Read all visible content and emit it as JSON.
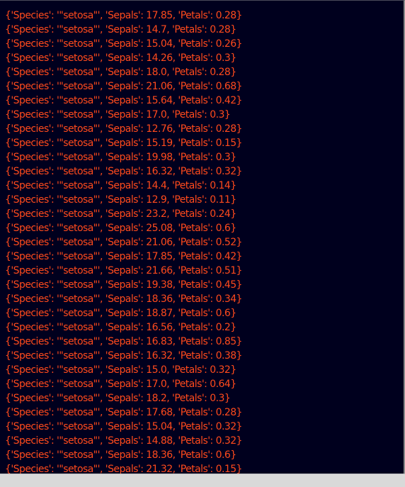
{
  "terminal": {
    "text_color": "#ff4a1c",
    "background_color": "#00001e",
    "lines": [
      "{'Species': '\"setosa\"', 'Sepals': 17.85, 'Petals': 0.28}",
      "{'Species': '\"setosa\"', 'Sepals': 14.7, 'Petals': 0.28}",
      "{'Species': '\"setosa\"', 'Sepals': 15.04, 'Petals': 0.26}",
      "{'Species': '\"setosa\"', 'Sepals': 14.26, 'Petals': 0.3}",
      "{'Species': '\"setosa\"', 'Sepals': 18.0, 'Petals': 0.28}",
      "{'Species': '\"setosa\"', 'Sepals': 21.06, 'Petals': 0.68}",
      "{'Species': '\"setosa\"', 'Sepals': 15.64, 'Petals': 0.42}",
      "{'Species': '\"setosa\"', 'Sepals': 17.0, 'Petals': 0.3}",
      "{'Species': '\"setosa\"', 'Sepals': 12.76, 'Petals': 0.28}",
      "{'Species': '\"setosa\"', 'Sepals': 15.19, 'Petals': 0.15}",
      "{'Species': '\"setosa\"', 'Sepals': 19.98, 'Petals': 0.3}",
      "{'Species': '\"setosa\"', 'Sepals': 16.32, 'Petals': 0.32}",
      "{'Species': '\"setosa\"', 'Sepals': 14.4, 'Petals': 0.14}",
      "{'Species': '\"setosa\"', 'Sepals': 12.9, 'Petals': 0.11}",
      "{'Species': '\"setosa\"', 'Sepals': 23.2, 'Petals': 0.24}",
      "{'Species': '\"setosa\"', 'Sepals': 25.08, 'Petals': 0.6}",
      "{'Species': '\"setosa\"', 'Sepals': 21.06, 'Petals': 0.52}",
      "{'Species': '\"setosa\"', 'Sepals': 17.85, 'Petals': 0.42}",
      "{'Species': '\"setosa\"', 'Sepals': 21.66, 'Petals': 0.51}",
      "{'Species': '\"setosa\"', 'Sepals': 19.38, 'Petals': 0.45}",
      "{'Species': '\"setosa\"', 'Sepals': 18.36, 'Petals': 0.34}",
      "{'Species': '\"setosa\"', 'Sepals': 18.87, 'Petals': 0.6}",
      "{'Species': '\"setosa\"', 'Sepals': 16.56, 'Petals': 0.2}",
      "{'Species': '\"setosa\"', 'Sepals': 16.83, 'Petals': 0.85}",
      "{'Species': '\"setosa\"', 'Sepals': 16.32, 'Petals': 0.38}",
      "{'Species': '\"setosa\"', 'Sepals': 15.0, 'Petals': 0.32}",
      "{'Species': '\"setosa\"', 'Sepals': 17.0, 'Petals': 0.64}",
      "{'Species': '\"setosa\"', 'Sepals': 18.2, 'Petals': 0.3}",
      "{'Species': '\"setosa\"', 'Sepals': 17.68, 'Petals': 0.28}",
      "{'Species': '\"setosa\"', 'Sepals': 15.04, 'Petals': 0.32}",
      "{'Species': '\"setosa\"', 'Sepals': 14.88, 'Petals': 0.32}",
      "{'Species': '\"setosa\"', 'Sepals': 18.36, 'Petals': 0.6}",
      "{'Species': '\"setosa\"', 'Sepals': 21.32, 'Petals': 0.15}"
    ]
  }
}
